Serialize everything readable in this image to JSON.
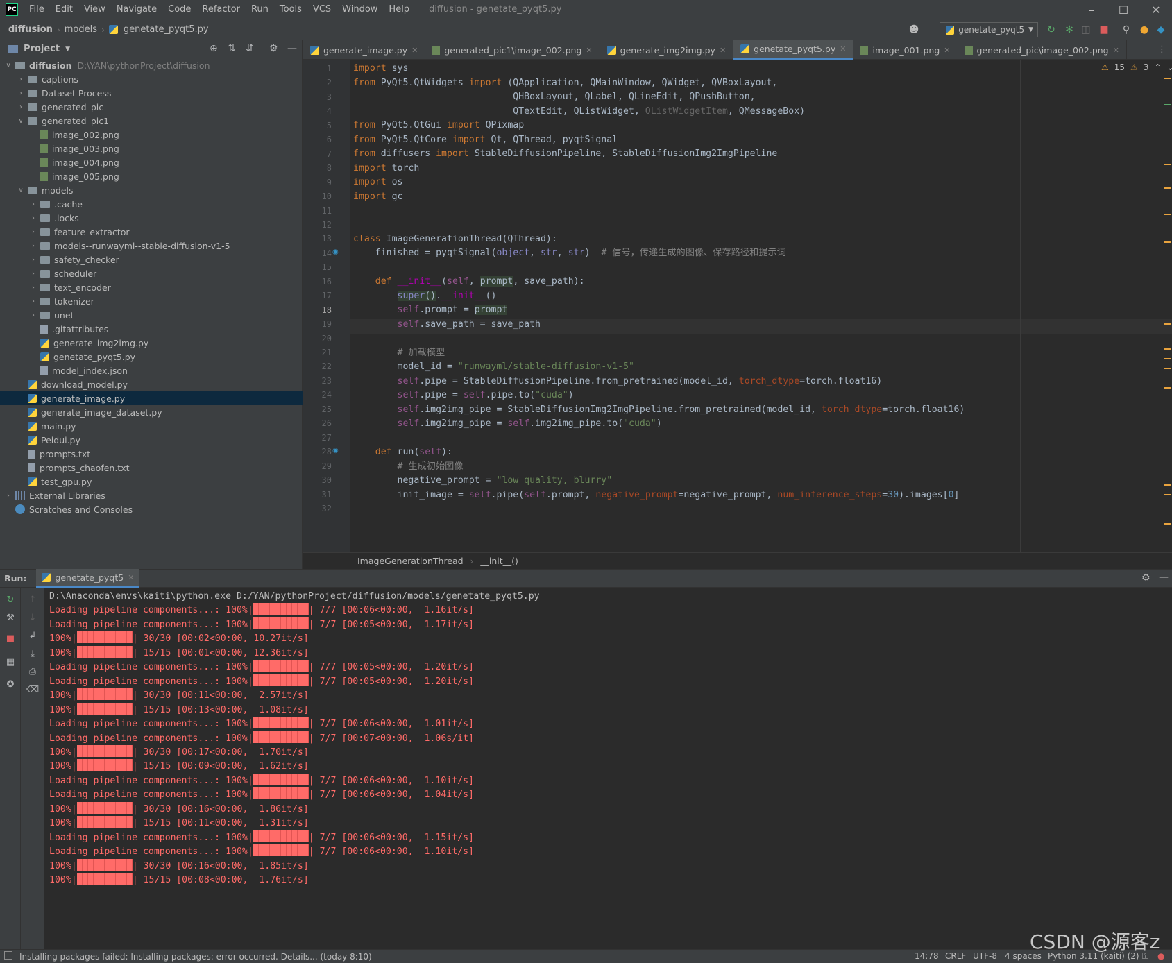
{
  "menu": {
    "logo": "PC",
    "items": [
      "File",
      "Edit",
      "View",
      "Navigate",
      "Code",
      "Refactor",
      "Run",
      "Tools",
      "VCS",
      "Window",
      "Help"
    ],
    "title": "diffusion - genetate_pyqt5.py"
  },
  "nav": {
    "crumbs": [
      "diffusion",
      "models",
      "genetate_pyqt5.py"
    ],
    "run_config": "genetate_pyqt5"
  },
  "project": {
    "title": "Project",
    "root": "diffusion",
    "root_path": "D:\\YAN\\pythonProject\\diffusion",
    "tree": [
      {
        "label": "captions",
        "type": "folder",
        "depth": 1,
        "expanded": false
      },
      {
        "label": "Dataset Process",
        "type": "folder",
        "depth": 1,
        "expanded": false
      },
      {
        "label": "generated_pic",
        "type": "folder",
        "depth": 1,
        "expanded": false
      },
      {
        "label": "generated_pic1",
        "type": "folder",
        "depth": 1,
        "expanded": true
      },
      {
        "label": "image_002.png",
        "type": "png",
        "depth": 2
      },
      {
        "label": "image_003.png",
        "type": "png",
        "depth": 2
      },
      {
        "label": "image_004.png",
        "type": "png",
        "depth": 2
      },
      {
        "label": "image_005.png",
        "type": "png",
        "depth": 2
      },
      {
        "label": "models",
        "type": "folder",
        "depth": 1,
        "expanded": true
      },
      {
        "label": ".cache",
        "type": "folder",
        "depth": 2,
        "expanded": false
      },
      {
        "label": ".locks",
        "type": "folder",
        "depth": 2,
        "expanded": false
      },
      {
        "label": "feature_extractor",
        "type": "folder",
        "depth": 2,
        "expanded": false
      },
      {
        "label": "models--runwayml--stable-diffusion-v1-5",
        "type": "folder",
        "depth": 2,
        "expanded": false
      },
      {
        "label": "safety_checker",
        "type": "folder",
        "depth": 2,
        "expanded": false
      },
      {
        "label": "scheduler",
        "type": "folder",
        "depth": 2,
        "expanded": false
      },
      {
        "label": "text_encoder",
        "type": "folder",
        "depth": 2,
        "expanded": false
      },
      {
        "label": "tokenizer",
        "type": "folder",
        "depth": 2,
        "expanded": false
      },
      {
        "label": "unet",
        "type": "folder",
        "depth": 2,
        "expanded": false
      },
      {
        "label": ".gitattributes",
        "type": "text",
        "depth": 2
      },
      {
        "label": "generate_img2img.py",
        "type": "py",
        "depth": 2
      },
      {
        "label": "genetate_pyqt5.py",
        "type": "py",
        "depth": 2
      },
      {
        "label": "model_index.json",
        "type": "text",
        "depth": 2
      },
      {
        "label": "download_model.py",
        "type": "py",
        "depth": 1
      },
      {
        "label": "generate_image.py",
        "type": "py",
        "depth": 1,
        "selected": true
      },
      {
        "label": "generate_image_dataset.py",
        "type": "py",
        "depth": 1
      },
      {
        "label": "main.py",
        "type": "py",
        "depth": 1
      },
      {
        "label": "Peidui.py",
        "type": "py",
        "depth": 1
      },
      {
        "label": "prompts.txt",
        "type": "text",
        "depth": 1
      },
      {
        "label": "prompts_chaofen.txt",
        "type": "text",
        "depth": 1
      },
      {
        "label": "test_gpu.py",
        "type": "py",
        "depth": 1
      },
      {
        "label": "External Libraries",
        "type": "lib",
        "depth": 0,
        "expanded": false
      },
      {
        "label": "Scratches and Consoles",
        "type": "scratch",
        "depth": 0
      }
    ]
  },
  "tabs": [
    {
      "label": "generate_image.py",
      "type": "py"
    },
    {
      "label": "generated_pic1\\image_002.png",
      "type": "png"
    },
    {
      "label": "generate_img2img.py",
      "type": "py"
    },
    {
      "label": "genetate_pyqt5.py",
      "type": "py",
      "active": true
    },
    {
      "label": "image_001.png",
      "type": "png"
    },
    {
      "label": "generated_pic\\image_002.png",
      "type": "png"
    }
  ],
  "editor": {
    "warnings": "15",
    "weak_warnings": "3",
    "current_line": 18,
    "line_numbers": [
      "1",
      "2",
      "3",
      "4",
      "5",
      "6",
      "7",
      "8",
      "9",
      "10",
      "11",
      "12",
      "13",
      "14",
      "15",
      "16",
      "17",
      "18",
      "19",
      "20",
      "21",
      "22",
      "23",
      "24",
      "25",
      "26",
      "27",
      "28",
      "29",
      "30",
      "31",
      "32"
    ],
    "breadcrumb": [
      "ImageGenerationThread",
      "__init__()"
    ]
  },
  "run": {
    "label": "Run:",
    "tab": "genetate_pyqt5",
    "command": "D:\\Anaconda\\envs\\kaiti\\python.exe D:/YAN/pythonProject/diffusion/models/genetate_pyqt5.py",
    "output": [
      {
        "prefix": "Loading pipeline components...: 100%|",
        "suffix": "| 7/7 [00:06<00:00,  1.16it/s]"
      },
      {
        "prefix": "Loading pipeline components...: 100%|",
        "suffix": "| 7/7 [00:05<00:00,  1.17it/s]"
      },
      {
        "prefix": "100%|",
        "suffix": "| 30/30 [00:02<00:00, 10.27it/s]"
      },
      {
        "prefix": "100%|",
        "suffix": "| 15/15 [00:01<00:00, 12.36it/s]"
      },
      {
        "prefix": "Loading pipeline components...: 100%|",
        "suffix": "| 7/7 [00:05<00:00,  1.20it/s]"
      },
      {
        "prefix": "Loading pipeline components...: 100%|",
        "suffix": "| 7/7 [00:05<00:00,  1.20it/s]"
      },
      {
        "prefix": "100%|",
        "suffix": "| 30/30 [00:11<00:00,  2.57it/s]"
      },
      {
        "prefix": "100%|",
        "suffix": "| 15/15 [00:13<00:00,  1.08it/s]"
      },
      {
        "prefix": "Loading pipeline components...: 100%|",
        "suffix": "| 7/7 [00:06<00:00,  1.01it/s]"
      },
      {
        "prefix": "Loading pipeline components...: 100%|",
        "suffix": "| 7/7 [00:07<00:00,  1.06s/it]"
      },
      {
        "prefix": "100%|",
        "suffix": "| 30/30 [00:17<00:00,  1.70it/s]"
      },
      {
        "prefix": "100%|",
        "suffix": "| 15/15 [00:09<00:00,  1.62it/s]"
      },
      {
        "prefix": "Loading pipeline components...: 100%|",
        "suffix": "| 7/7 [00:06<00:00,  1.10it/s]"
      },
      {
        "prefix": "Loading pipeline components...: 100%|",
        "suffix": "| 7/7 [00:06<00:00,  1.04it/s]"
      },
      {
        "prefix": "100%|",
        "suffix": "| 30/30 [00:16<00:00,  1.86it/s]"
      },
      {
        "prefix": "100%|",
        "suffix": "| 15/15 [00:11<00:00,  1.31it/s]"
      },
      {
        "prefix": "Loading pipeline components...: 100%|",
        "suffix": "| 7/7 [00:06<00:00,  1.15it/s]"
      },
      {
        "prefix": "Loading pipeline components...: 100%|",
        "suffix": "| 7/7 [00:06<00:00,  1.10it/s]"
      },
      {
        "prefix": "100%|",
        "suffix": "| 30/30 [00:16<00:00,  1.85it/s]"
      },
      {
        "prefix": "100%|",
        "suffix": "| 15/15 [00:08<00:00,  1.76it/s]"
      }
    ]
  },
  "status": {
    "message": "Installing packages failed: Installing packages: error occurred. Details... (today 8:10)",
    "position": "14:78",
    "line_sep": "CRLF",
    "encoding": "UTF-8",
    "indent": "4 spaces",
    "interpreter": "Python 3.11 (kaiti) (2)"
  },
  "watermark": "CSDN @源客z",
  "colors": {
    "accent": "#4a88c7",
    "error_red": "#ff6b68",
    "keyword": "#cc7832",
    "string": "#6a8759",
    "warning": "#e8a33e"
  }
}
